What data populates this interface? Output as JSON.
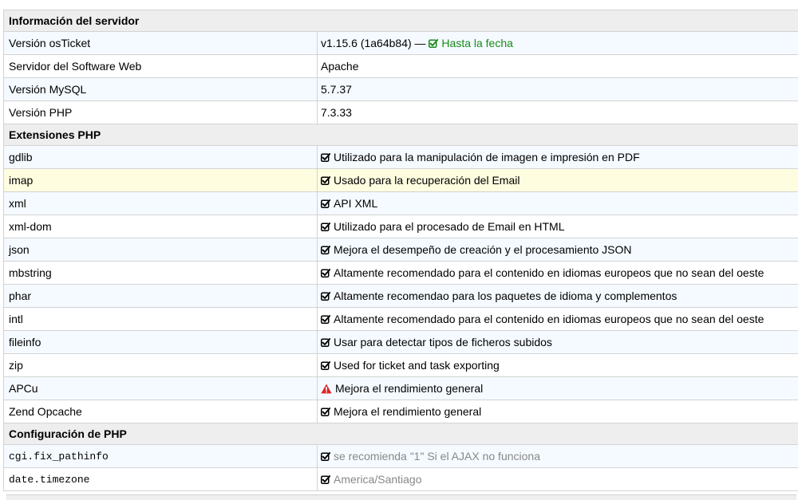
{
  "colors": {
    "ok": "#1a8a1a",
    "warn": "#d9262b",
    "muted": "#888888",
    "section_bg": "#eeeeee",
    "highlight": "#fffde0",
    "stripe": "#f4faff"
  },
  "server": {
    "title": "Información del servidor",
    "rows": [
      {
        "label": "Versión osTicket",
        "version": "v1.15.6 (1a64b84) — ",
        "status_icon": "check-square-icon",
        "status": "Hasta la fecha"
      },
      {
        "label": "Servidor del Software Web",
        "value": "Apache"
      },
      {
        "label": "Versión MySQL",
        "value": "5.7.37"
      },
      {
        "label": "Versión PHP",
        "value": "7.3.33"
      }
    ]
  },
  "extensions": {
    "title": "Extensiones PHP",
    "rows": [
      {
        "name": "gdlib",
        "icon": "check-square-icon",
        "desc": "Utilizado para la manipulación de imagen e impresión en PDF"
      },
      {
        "name": "imap",
        "icon": "check-square-icon",
        "desc": "Usado para la recuperación del Email"
      },
      {
        "name": "xml",
        "icon": "check-square-icon",
        "desc": "API XML"
      },
      {
        "name": "xml-dom",
        "icon": "check-square-icon",
        "desc": "Utilizado para el procesado de Email en HTML"
      },
      {
        "name": "json",
        "icon": "check-square-icon",
        "desc": "Mejora el desempeño de creación y el procesamiento JSON"
      },
      {
        "name": "mbstring",
        "icon": "check-square-icon",
        "desc": "Altamente recomendado para el contenido en idiomas europeos que no sean del oeste"
      },
      {
        "name": "phar",
        "icon": "check-square-icon",
        "desc": "Altamente recomendao para los paquetes de idioma y complementos"
      },
      {
        "name": "intl",
        "icon": "check-square-icon",
        "desc": "Altamente recomendado para el contenido en idiomas europeos que no sean del oeste"
      },
      {
        "name": "fileinfo",
        "icon": "check-square-icon",
        "desc": "Usar para detectar tipos de ficheros subidos"
      },
      {
        "name": "zip",
        "icon": "check-square-icon",
        "desc": "Used for ticket and task exporting"
      },
      {
        "name": "APCu",
        "icon": "warning-icon",
        "desc": "Mejora el rendimiento general"
      },
      {
        "name": "Zend Opcache",
        "icon": "check-square-icon",
        "desc": "Mejora el rendimiento general"
      }
    ]
  },
  "php_config": {
    "title": "Configuración de PHP",
    "rows": [
      {
        "name": "cgi.fix_pathinfo",
        "icon": "check-square-icon",
        "desc": "se recomienda \"1\" Si el AJAX no funciona"
      },
      {
        "name": "date.timezone",
        "icon": "check-square-icon",
        "desc": "America/Santiago"
      }
    ]
  }
}
